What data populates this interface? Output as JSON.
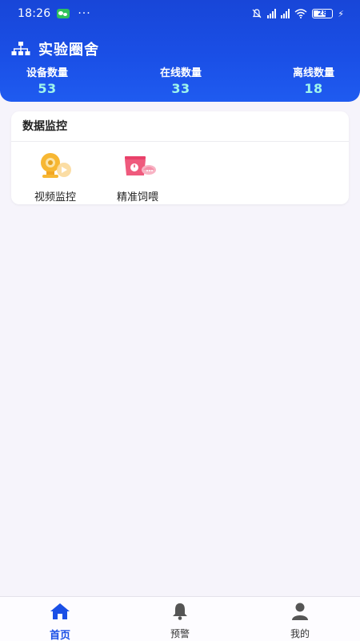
{
  "status_bar": {
    "time": "18:26",
    "more": "···",
    "battery": "28"
  },
  "header": {
    "title": "实验圈舍",
    "stats": [
      {
        "label": "设备数量",
        "value": "53"
      },
      {
        "label": "在线数量",
        "value": "33"
      },
      {
        "label": "离线数量",
        "value": "18"
      }
    ]
  },
  "card": {
    "title": "数据监控",
    "tiles": [
      {
        "label": "视频监控",
        "icon": "video-camera-icon"
      },
      {
        "label": "精准饲喂",
        "icon": "feeding-scale-icon"
      }
    ]
  },
  "nav": {
    "items": [
      {
        "label": "首页",
        "icon": "home-icon",
        "active": true
      },
      {
        "label": "预警",
        "icon": "bell-icon",
        "active": false
      },
      {
        "label": "我的",
        "icon": "user-icon",
        "active": false
      }
    ]
  },
  "colors": {
    "header_blue": "#1a4fe6",
    "stat_value": "#9ff5ec",
    "active_nav": "#1a4fe6",
    "background": "#f6f4fb"
  }
}
